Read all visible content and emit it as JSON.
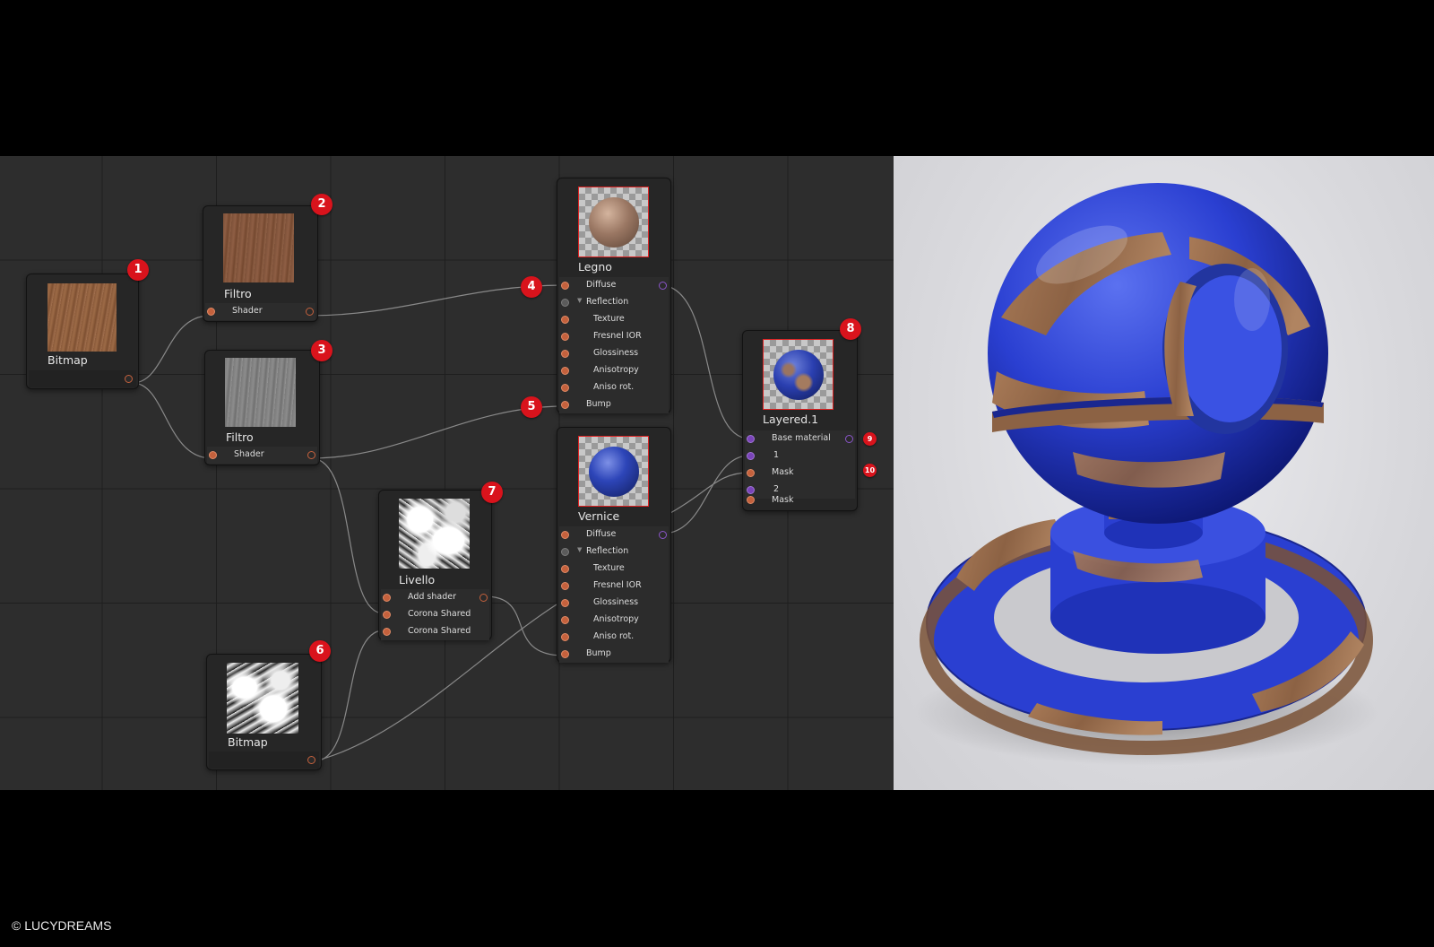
{
  "nodes": {
    "bitmap1": {
      "title": "Bitmap"
    },
    "filtro2": {
      "title": "Filtro",
      "port": "Shader"
    },
    "filtro3": {
      "title": "Filtro",
      "port": "Shader"
    },
    "legno": {
      "title": "Legno",
      "ports": [
        "Diffuse",
        "Reflection",
        "Texture",
        "Fresnel IOR",
        "Glossiness",
        "Anisotropy",
        "Aniso rot.",
        "Bump"
      ]
    },
    "vernice": {
      "title": "Vernice",
      "ports": [
        "Diffuse",
        "Reflection",
        "Texture",
        "Fresnel IOR",
        "Glossiness",
        "Anisotropy",
        "Aniso rot.",
        "Bump"
      ]
    },
    "livello": {
      "title": "Livello",
      "ports": [
        "Add shader",
        "Corona Shared",
        "Corona Shared"
      ]
    },
    "bitmap6": {
      "title": "Bitmap"
    },
    "layered": {
      "title": "Layered.1",
      "ports": [
        "Base material",
        "1",
        "Mask",
        "2",
        "Mask"
      ]
    }
  },
  "badges": [
    "1",
    "2",
    "3",
    "4",
    "5",
    "6",
    "7",
    "8",
    "9",
    "10"
  ],
  "copyright": "© LUCYDREAMS",
  "colors": {
    "badge": "#d9131c",
    "port_orange": "#c4613d",
    "port_purple": "#7a44b9",
    "paint_blue": "#2a3fd1",
    "wood": "#9a6a48"
  }
}
